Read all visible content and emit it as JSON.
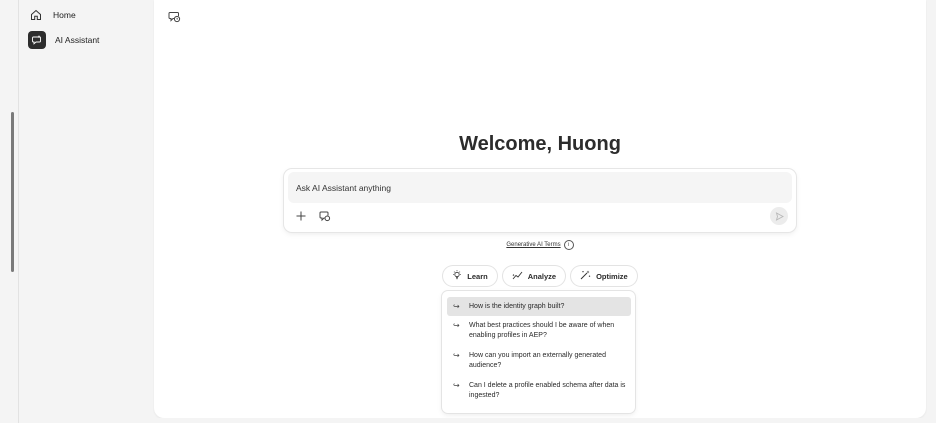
{
  "sidebar": {
    "items": [
      {
        "label": "Home",
        "icon": "home-icon"
      },
      {
        "label": "AI Assistant",
        "icon": "ai-assistant-icon"
      }
    ]
  },
  "main": {
    "new_chat_icon": "chat-history-icon",
    "welcome": "Welcome, Huong",
    "prompt": {
      "placeholder": "Ask AI Assistant anything",
      "value": ""
    },
    "terms": {
      "link": "Generative AI Terms"
    },
    "chips": [
      {
        "label": "Learn",
        "icon": "lightbulb-icon"
      },
      {
        "label": "Analyze",
        "icon": "analyze-icon"
      },
      {
        "label": "Optimize",
        "icon": "magic-wand-icon"
      }
    ],
    "suggestions": [
      {
        "text": "How is the identity graph built?"
      },
      {
        "text": "What best practices should I be aware of when enabling profiles in AEP?"
      },
      {
        "text": "How can you import an externally generated audience?"
      },
      {
        "text": "Can I delete a profile enabled schema after data is ingested?"
      }
    ]
  },
  "colors": {
    "background": "#f4f4f4",
    "panel": "#ffffff",
    "active_suggestion": "#e4e4e4",
    "ai_icon_bg": "#2d2d2d"
  }
}
